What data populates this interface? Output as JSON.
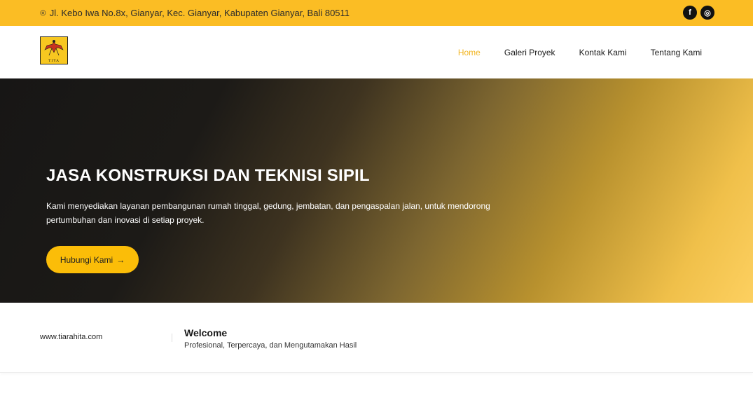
{
  "topbar": {
    "address": "Jl. Kebo Iwa No.8x, Gianyar, Kec. Gianyar, Kabupaten Gianyar, Bali 80511",
    "pin_icon": "◎",
    "social": [
      {
        "name": "facebook",
        "glyph": "f"
      },
      {
        "name": "instagram",
        "glyph": "◎"
      }
    ]
  },
  "logo": {
    "text": "TIYA"
  },
  "nav": {
    "items": [
      {
        "label": "Home",
        "active": true
      },
      {
        "label": "Galeri Proyek"
      },
      {
        "label": "Kontak Kami"
      },
      {
        "label": "Tentang Kami"
      }
    ]
  },
  "hero": {
    "title": "JASA KONSTRUKSI DAN TEKNISI SIPIL",
    "description": "Kami menyediakan layanan pembangunan rumah tinggal, gedung, jembatan, dan pengaspalan jalan, untuk mendorong pertumbuhan dan inovasi di setiap proyek.",
    "cta_label": "Hubungi Kami",
    "cta_arrow": "→"
  },
  "info": {
    "website": "www.tiarahita.com",
    "welcome": "Welcome",
    "tagline": "Profesional, Terpercaya, dan Mengutamakan Hasil"
  },
  "colors": {
    "accent": "#fbbd24",
    "nav_active": "#f2b624"
  }
}
